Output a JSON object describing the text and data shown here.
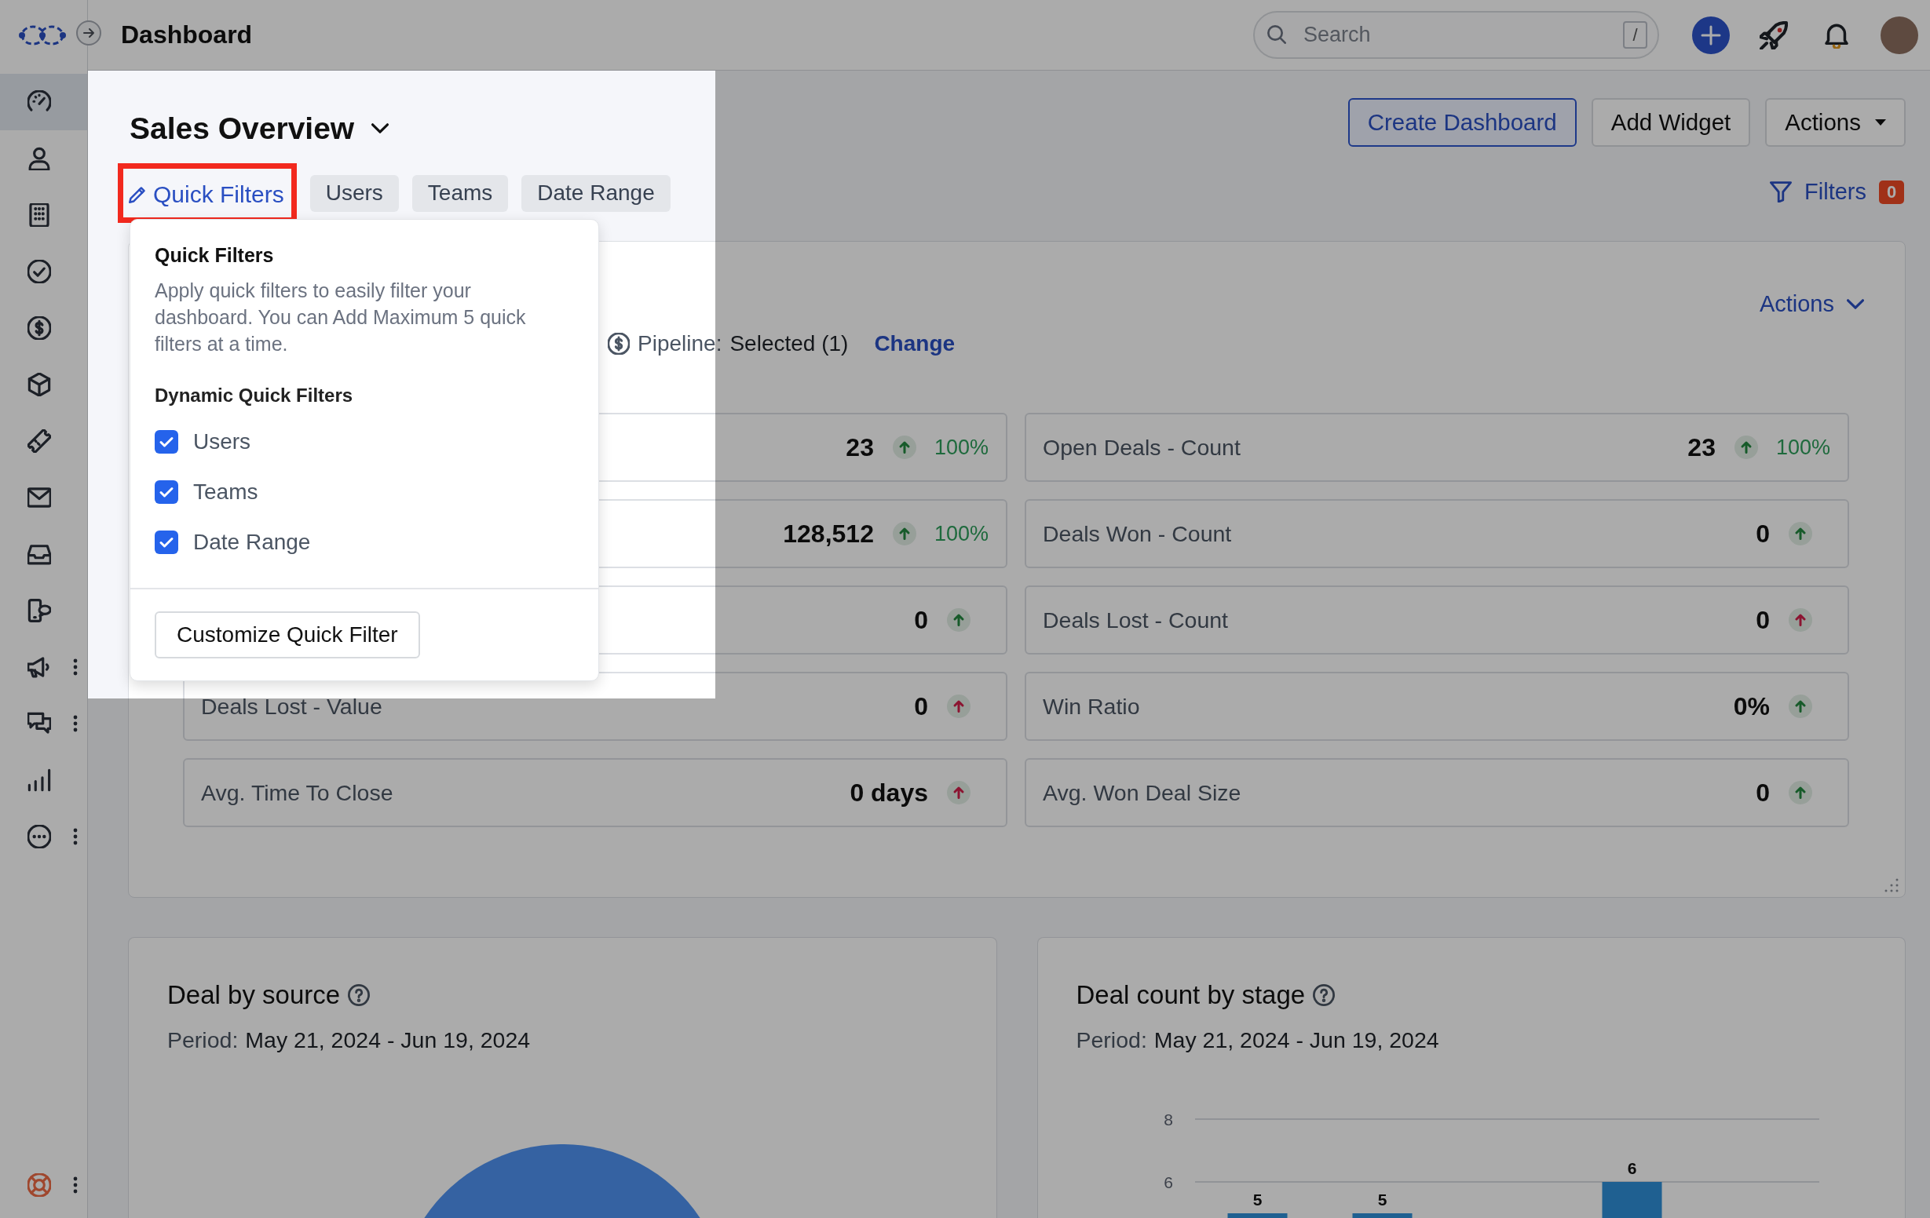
{
  "header": {
    "title": "Dashboard",
    "search": {
      "placeholder": "Search",
      "shortcut": "/"
    }
  },
  "sidebar": {
    "items": [
      {
        "kind": "dashboards",
        "selected": true,
        "has_menu": false
      },
      {
        "kind": "contacts",
        "selected": false,
        "has_menu": false
      },
      {
        "kind": "accounts",
        "selected": false,
        "has_menu": false
      },
      {
        "kind": "tasks",
        "selected": false,
        "has_menu": false
      },
      {
        "kind": "deals",
        "selected": false,
        "has_menu": false
      },
      {
        "kind": "products",
        "selected": false,
        "has_menu": false
      },
      {
        "kind": "tickets",
        "selected": false,
        "has_menu": false
      },
      {
        "kind": "email",
        "selected": false,
        "has_menu": false
      },
      {
        "kind": "inbox",
        "selected": false,
        "has_menu": false
      },
      {
        "kind": "phone",
        "selected": false,
        "has_menu": false
      },
      {
        "kind": "campaigns",
        "selected": false,
        "has_menu": true
      },
      {
        "kind": "chats",
        "selected": false,
        "has_menu": true
      },
      {
        "kind": "reports",
        "selected": false,
        "has_menu": false
      },
      {
        "kind": "more",
        "selected": false,
        "has_menu": true
      }
    ],
    "footer": {
      "kind": "support",
      "has_menu": true
    }
  },
  "toolbar": {
    "buttons": [
      {
        "label": "Create Dashboard",
        "kind": "primary"
      },
      {
        "label": "Add Widget",
        "kind": "secondary"
      },
      {
        "label": "Actions",
        "kind": "dropdown"
      }
    ],
    "filters": {
      "label": "Filters",
      "count": "0"
    }
  },
  "dashboard": {
    "title": "Sales Overview",
    "filter_tabs": [
      {
        "label": "Quick Filters",
        "kind": "edit",
        "highlighted": true
      },
      {
        "label": "Users",
        "kind": "chip",
        "highlighted": false
      },
      {
        "label": "Teams",
        "kind": "chip",
        "highlighted": false
      },
      {
        "label": "Date Range",
        "kind": "chip",
        "highlighted": false
      }
    ]
  },
  "quick_filters_popup": {
    "title": "Quick Filters",
    "description": "Apply quick filters to easily filter your dashboard. You can Add Maximum 5 quick filters at a time.",
    "section_title": "Dynamic Quick Filters",
    "options": [
      {
        "label": "Users",
        "checked": true
      },
      {
        "label": "Teams",
        "checked": true
      },
      {
        "label": "Date Range",
        "checked": true
      }
    ],
    "button": "Customize Quick Filter"
  },
  "widget": {
    "actions": "Actions",
    "filter": {
      "label": "Pipeline:",
      "value": "Selected (1)",
      "link": "Change"
    },
    "metrics": [
      {
        "value": "23",
        "positive": true,
        "change": "100%"
      },
      {
        "label": "Open Deals - Count",
        "value": "23",
        "positive": true,
        "change": "100%"
      },
      {
        "value": "128,512",
        "positive": true,
        "change": "100%"
      },
      {
        "label": "Deals Won - Count",
        "value": "0",
        "positive": true
      },
      {
        "value": "0",
        "positive": true
      },
      {
        "label": "Deals Lost - Count",
        "value": "0",
        "positive": false
      },
      {
        "label": "Deals Lost - Value",
        "value": "0",
        "positive": false
      },
      {
        "label": "Win Ratio",
        "value": "0%",
        "positive": true
      },
      {
        "label": "Avg. Time To Close",
        "value": "0 days",
        "positive": false
      },
      {
        "label": "Avg. Won Deal Size",
        "value": "0",
        "positive": true
      }
    ]
  },
  "charts": [
    {
      "kind": "pie",
      "title": "Deal by source",
      "period_label": "Period:",
      "period": "May 21, 2024 - Jun 19, 2024"
    },
    {
      "kind": "bar",
      "title": "Deal count by stage",
      "period_label": "Period:",
      "period": "May 21, 2024 - Jun 19, 2024",
      "chart_data": {
        "type": "bar",
        "values": [
          5,
          5,
          null,
          6,
          null
        ],
        "ylim": [
          4.85,
          8
        ],
        "yticks": [
          6,
          8
        ],
        "data_labels": true
      }
    }
  ]
}
